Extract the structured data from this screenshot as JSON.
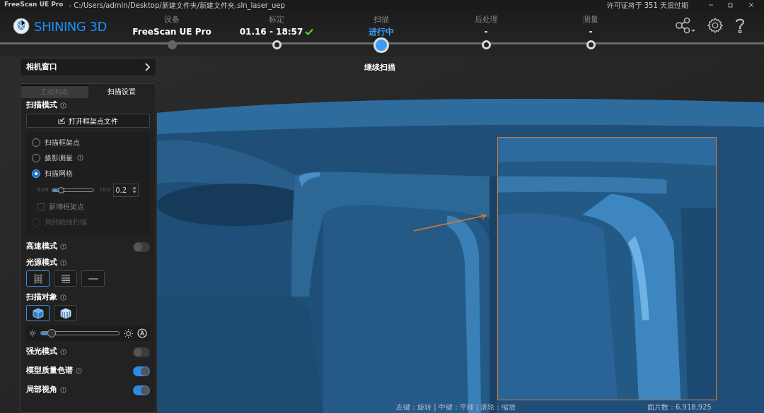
{
  "title_bar": {
    "app": "FreeScan UE Pro",
    "path": "-  C:/Users/admin/Desktop/新建文件夹/新建文件夹.sln_laser_uep",
    "license": "许可证将于 351 天后过期"
  },
  "logo": "SHINING 3D",
  "steps": [
    {
      "label": "设备",
      "value": "FreeScan UE Pro",
      "selected": false,
      "completed": true,
      "verified": false
    },
    {
      "label": "标定",
      "value": "01.16 - 18:57",
      "selected": false,
      "completed": false,
      "verified": true
    },
    {
      "label": "扫描",
      "value": "进行中",
      "selected": true,
      "completed": false,
      "verified": false
    },
    {
      "label": "后处理",
      "value": "-",
      "selected": false,
      "completed": false,
      "verified": false
    },
    {
      "label": "测量",
      "value": "-",
      "selected": false,
      "completed": false,
      "verified": false
    }
  ],
  "step_tooltip": "继续扫描",
  "camera_window": "相机窗口",
  "tabs": [
    {
      "label": "工程列表",
      "selected": false
    },
    {
      "label": "扫描设置",
      "selected": true
    }
  ],
  "scan_mode": {
    "label": "扫描模式",
    "open_button": "打开框架点文件",
    "options": [
      {
        "label": "扫描框架点",
        "selected": false,
        "disabled": false,
        "info": false
      },
      {
        "label": "摄影测量",
        "selected": false,
        "disabled": false,
        "info": true
      },
      {
        "label": "扫描网格",
        "selected": true,
        "disabled": false,
        "info": false
      }
    ],
    "slider": {
      "min": "0.05",
      "max": "10.0",
      "level": 0.15,
      "value": "0.2"
    },
    "checkbox": {
      "label": "新增框架点",
      "checked": false,
      "disabled": true
    },
    "extra_option": {
      "label": "局部精细扫描",
      "selected": false,
      "disabled": true
    }
  },
  "settings": [
    {
      "kind": "toggle",
      "label": "高速模式",
      "on": false
    },
    {
      "kind": "light_source",
      "label": "光源模式",
      "options": [
        {
          "selected": true
        },
        {
          "selected": false
        },
        {
          "selected": false
        }
      ]
    },
    {
      "kind": "scan_object",
      "label": "扫描对象",
      "options": [
        {
          "selected": true
        },
        {
          "selected": false
        }
      ]
    },
    {
      "kind": "exposure",
      "level": 0.08
    },
    {
      "kind": "toggle",
      "label": "强光模式",
      "on": false
    },
    {
      "kind": "toggle",
      "label": "模型质量色谱",
      "on": true
    },
    {
      "kind": "toggle",
      "label": "局部视角",
      "on": true
    }
  ],
  "status_bar": {
    "hint": "左键：旋转 | 中键：平移 | 滚轮：缩放",
    "facets": "面片数：6,918,925"
  }
}
